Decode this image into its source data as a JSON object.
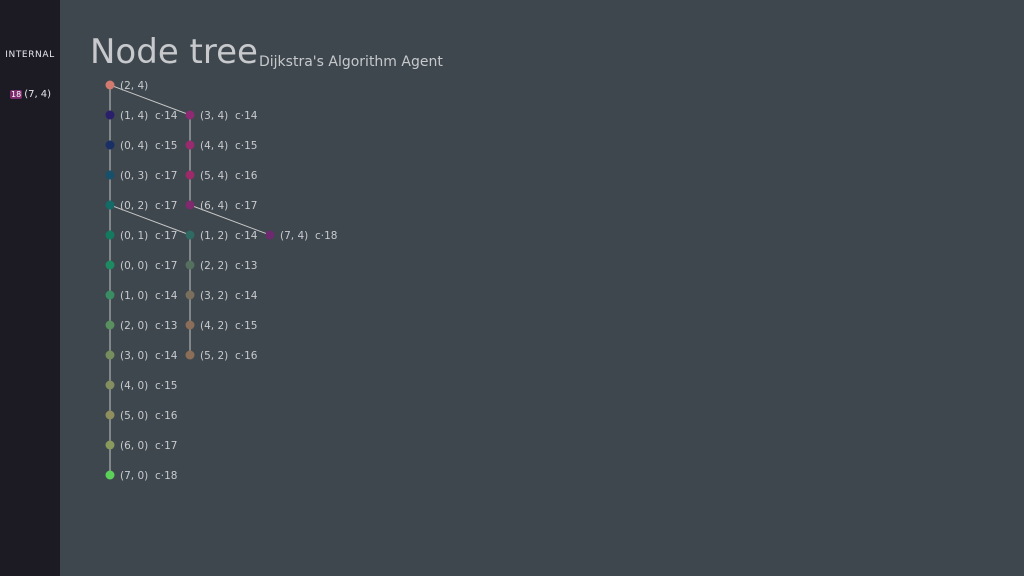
{
  "sidebar": {
    "heading": "INTERNAL",
    "entry": {
      "badge": "18",
      "label": "(7, 4)",
      "badge_color": "#7b2a6b"
    }
  },
  "header": {
    "title": "Node tree",
    "subtitle": "Dijkstra's Algorithm Agent"
  },
  "tree": {
    "line_color": "#c8c8c8",
    "nodes": [
      {
        "id": "n24",
        "label": "(2, 4)",
        "cost": "",
        "color": "#d27a6e",
        "col": 0,
        "row": 0,
        "parent": null
      },
      {
        "id": "n14",
        "label": "(1, 4)",
        "cost": "c·14",
        "color": "#2a1f6b",
        "col": 0,
        "row": 1,
        "parent": "n24"
      },
      {
        "id": "n04",
        "label": "(0, 4)",
        "cost": "c·15",
        "color": "#1a2f66",
        "col": 0,
        "row": 2,
        "parent": "n14"
      },
      {
        "id": "n03",
        "label": "(0, 3)",
        "cost": "c·17",
        "color": "#17506a",
        "col": 0,
        "row": 3,
        "parent": "n04"
      },
      {
        "id": "n02",
        "label": "(0, 2)",
        "cost": "c·17",
        "color": "#136a66",
        "col": 0,
        "row": 4,
        "parent": "n03"
      },
      {
        "id": "n01",
        "label": "(0, 1)",
        "cost": "c·17",
        "color": "#137a60",
        "col": 0,
        "row": 5,
        "parent": "n02"
      },
      {
        "id": "n00",
        "label": "(0, 0)",
        "cost": "c·17",
        "color": "#1d8a62",
        "col": 0,
        "row": 6,
        "parent": "n01"
      },
      {
        "id": "n10",
        "label": "(1, 0)",
        "cost": "c·14",
        "color": "#3a8d62",
        "col": 0,
        "row": 7,
        "parent": "n00"
      },
      {
        "id": "n20",
        "label": "(2, 0)",
        "cost": "c·13",
        "color": "#5a8f60",
        "col": 0,
        "row": 8,
        "parent": "n10"
      },
      {
        "id": "n30",
        "label": "(3, 0)",
        "cost": "c·14",
        "color": "#768e5e",
        "col": 0,
        "row": 9,
        "parent": "n20"
      },
      {
        "id": "n40",
        "label": "(4, 0)",
        "cost": "c·15",
        "color": "#848e5e",
        "col": 0,
        "row": 10,
        "parent": "n30"
      },
      {
        "id": "n50",
        "label": "(5, 0)",
        "cost": "c·16",
        "color": "#8f8f5e",
        "col": 0,
        "row": 11,
        "parent": "n40"
      },
      {
        "id": "n60",
        "label": "(6, 0)",
        "cost": "c·17",
        "color": "#8a9a5c",
        "col": 0,
        "row": 12,
        "parent": "n50"
      },
      {
        "id": "n70",
        "label": "(7, 0)",
        "cost": "c·18",
        "color": "#5cd15a",
        "col": 0,
        "row": 13,
        "parent": "n60"
      },
      {
        "id": "n34",
        "label": "(3, 4)",
        "cost": "c·14",
        "color": "#8e2a72",
        "col": 1,
        "row": 1,
        "parent": "n24"
      },
      {
        "id": "n44",
        "label": "(4, 4)",
        "cost": "c·15",
        "color": "#982a6e",
        "col": 1,
        "row": 2,
        "parent": "n34"
      },
      {
        "id": "n54",
        "label": "(5, 4)",
        "cost": "c·16",
        "color": "#9c2a68",
        "col": 1,
        "row": 3,
        "parent": "n44"
      },
      {
        "id": "n64",
        "label": "(6, 4)",
        "cost": "c·17",
        "color": "#7f2a6c",
        "col": 1,
        "row": 4,
        "parent": "n54"
      },
      {
        "id": "n74",
        "label": "(7, 4)",
        "cost": "c·18",
        "color": "#6d2a6e",
        "col": 2,
        "row": 5,
        "parent": "n64"
      },
      {
        "id": "n12",
        "label": "(1, 2)",
        "cost": "c·14",
        "color": "#2f6a62",
        "col": 1,
        "row": 5,
        "parent": "n02"
      },
      {
        "id": "n22",
        "label": "(2, 2)",
        "cost": "c·13",
        "color": "#55705f",
        "col": 1,
        "row": 6,
        "parent": "n12"
      },
      {
        "id": "n32",
        "label": "(3, 2)",
        "cost": "c·14",
        "color": "#7a6e5c",
        "col": 1,
        "row": 7,
        "parent": "n22"
      },
      {
        "id": "n42",
        "label": "(4, 2)",
        "cost": "c·15",
        "color": "#8a6e5a",
        "col": 1,
        "row": 8,
        "parent": "n32"
      },
      {
        "id": "n52",
        "label": "(5, 2)",
        "cost": "c·16",
        "color": "#8c6e58",
        "col": 1,
        "row": 9,
        "parent": "n42"
      }
    ]
  }
}
